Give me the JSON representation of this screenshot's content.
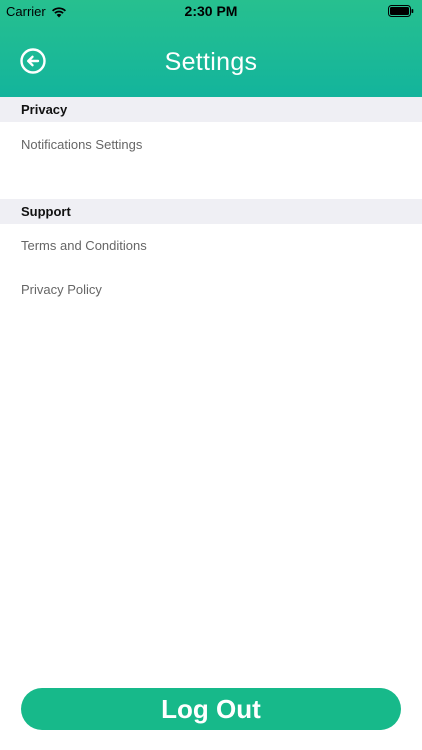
{
  "status_bar": {
    "carrier": "Carrier",
    "time": "2:30 PM",
    "wifi_icon": "wifi-icon",
    "battery_icon": "battery-full-icon"
  },
  "nav": {
    "title": "Settings",
    "back_icon": "back-arrow-circle-icon"
  },
  "sections": [
    {
      "header": "Privacy",
      "items": [
        {
          "label": "Notifications Settings"
        }
      ]
    },
    {
      "header": "Support",
      "items": [
        {
          "label": "Terms and Conditions"
        },
        {
          "label": "Privacy Policy"
        }
      ]
    }
  ],
  "logout": {
    "label": "Log Out"
  },
  "colors": {
    "header_gradient_top": "#27c08f",
    "header_gradient_bottom": "#13b49c",
    "section_header_bg": "#efeff4",
    "row_text": "#666666",
    "logout_bg": "#17b98a"
  }
}
